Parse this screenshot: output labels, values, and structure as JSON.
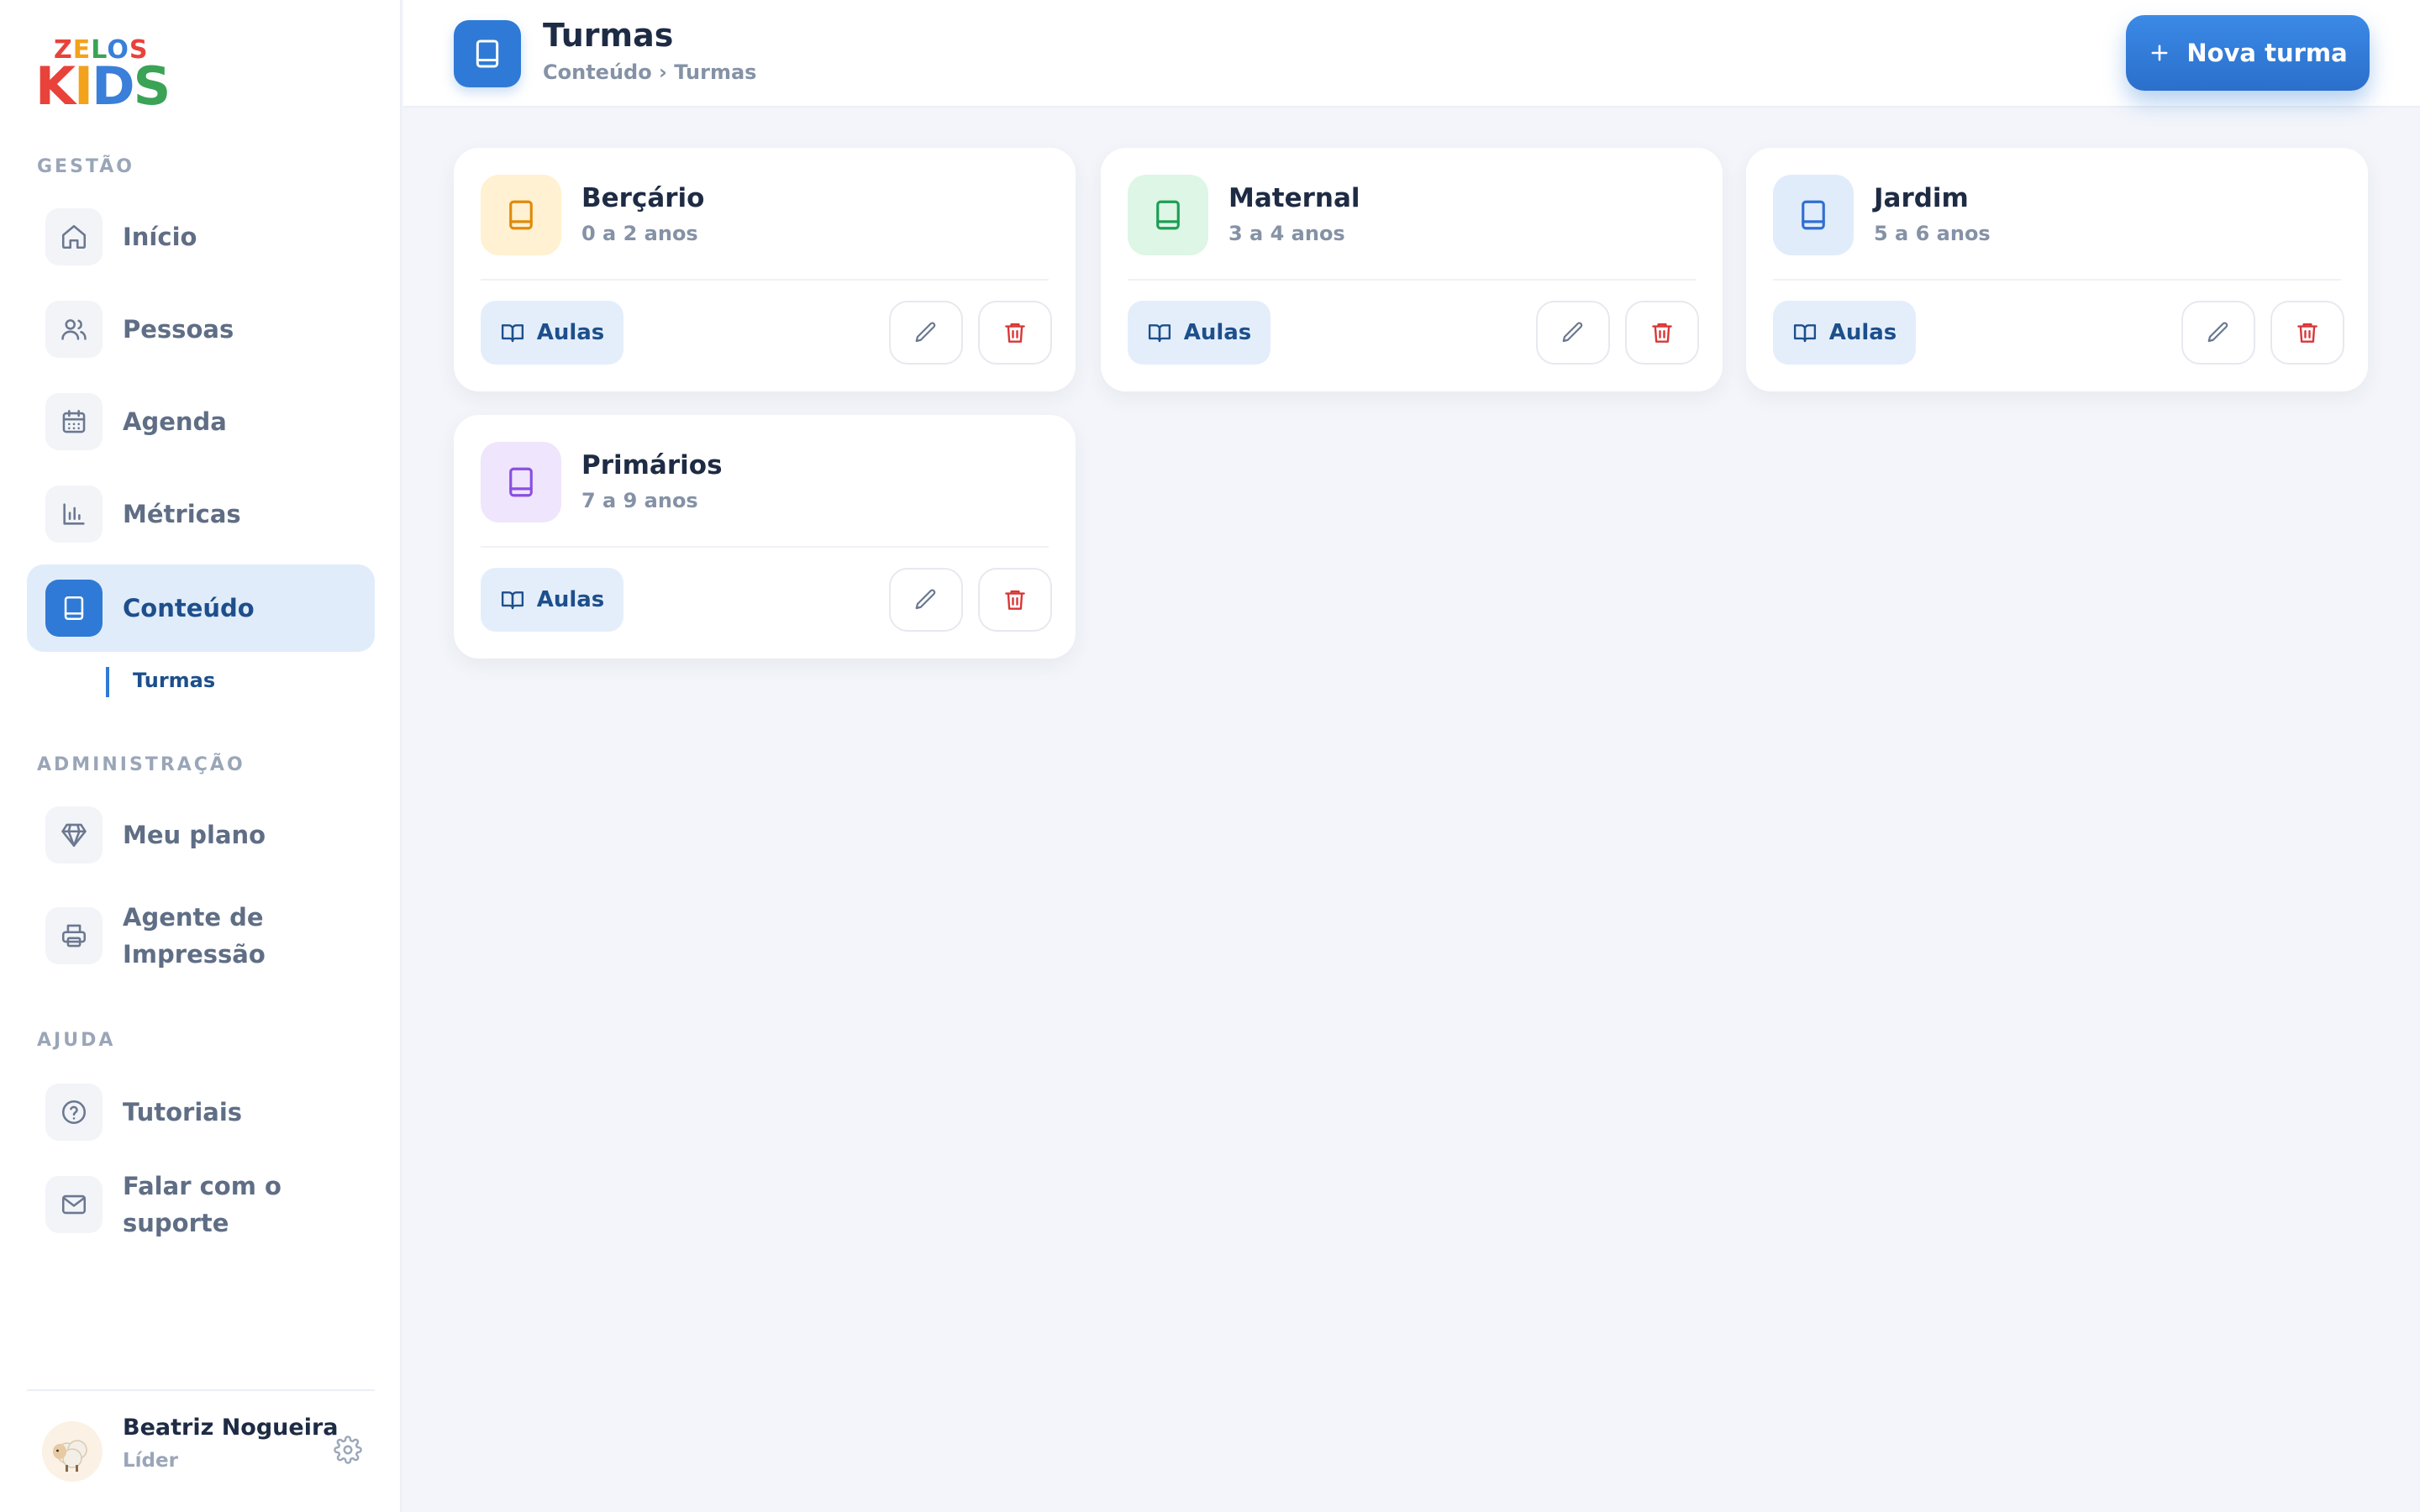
{
  "brand": {
    "line1": "ZELOS",
    "line2": "KIDS"
  },
  "sidebar": {
    "sections": {
      "gestao": "GESTÃO",
      "administracao": "ADMINISTRAÇÃO",
      "ajuda": "AJUDA"
    },
    "items": [
      {
        "label": "Início",
        "icon": "home-icon"
      },
      {
        "label": "Pessoas",
        "icon": "users-icon"
      },
      {
        "label": "Agenda",
        "icon": "calendar-icon"
      },
      {
        "label": "Métricas",
        "icon": "bar-chart-icon"
      },
      {
        "label": "Conteúdo",
        "icon": "book-icon",
        "active": true
      },
      {
        "label": "Meu plano",
        "icon": "diamond-icon"
      },
      {
        "label": "Agente de Impressão",
        "icon": "printer-icon"
      },
      {
        "label": "Tutoriais",
        "icon": "help-circle-icon"
      },
      {
        "label": "Falar com o suporte",
        "icon": "mail-icon"
      }
    ],
    "sub_item": "Turmas"
  },
  "user": {
    "name": "Beatriz Nogueira",
    "role": "Líder",
    "avatar": "sheep-avatar"
  },
  "header": {
    "title": "Turmas",
    "breadcrumb": "Conteúdo › Turmas",
    "new_button": "Nova turma"
  },
  "classes": [
    {
      "name": "Berçário",
      "age": "0 a 2 anos",
      "color": "#e08a0b",
      "bg": "#fff1d1",
      "aulas": "Aulas"
    },
    {
      "name": "Maternal",
      "age": "3 a 4 anos",
      "color": "#1f9d55",
      "bg": "#ddf6e6",
      "aulas": "Aulas"
    },
    {
      "name": "Jardim",
      "age": "5 a 6 anos",
      "color": "#2f6fd1",
      "bg": "#e1ecfb",
      "aulas": "Aulas"
    },
    {
      "name": "Primários",
      "age": "7 a 9 anos",
      "color": "#8a4fe0",
      "bg": "#efe5fc",
      "aulas": "Aulas"
    }
  ],
  "colors": {
    "accent": "#2f7ad6",
    "danger": "#d93636",
    "text": "#1e2b44",
    "muted": "#8592a6"
  }
}
